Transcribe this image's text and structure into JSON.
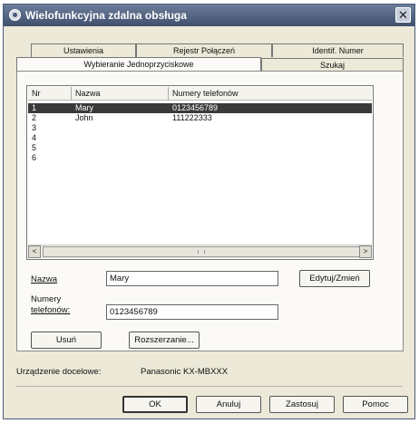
{
  "window": {
    "title": "Wielofunkcyjna zdalna obsługa",
    "close_glyph": "✕"
  },
  "tabs": {
    "row1": [
      "Ustawienia",
      "Rejestr Połączeń",
      "Identif. Numer"
    ],
    "row2": [
      "Wybieranie Jednoprzyciskowe",
      "Szukaj"
    ],
    "active": "Wybieranie Jednoprzyciskowe"
  },
  "list": {
    "headers": [
      "Nr",
      "Nazwa",
      "Numery telefonów"
    ],
    "rows": [
      {
        "nr": "1",
        "name": "Mary",
        "phone": "0123456789",
        "selected": true
      },
      {
        "nr": "2",
        "name": "John",
        "phone": "111222333"
      },
      {
        "nr": "3",
        "name": "",
        "phone": ""
      },
      {
        "nr": "4",
        "name": "",
        "phone": ""
      },
      {
        "nr": "5",
        "name": "",
        "phone": ""
      },
      {
        "nr": "6",
        "name": "",
        "phone": ""
      }
    ],
    "scroll_left": "<",
    "scroll_right": ">"
  },
  "form": {
    "name_label": "Nazwa",
    "name_value": "Mary",
    "phone_label_line1": "Numery",
    "phone_label_line2": "telefonów:",
    "phone_value": "0123456789",
    "edit_button": "Edytuj/Zmień",
    "delete_button": "Usuń",
    "expand_button": "Rozszerzanie..."
  },
  "device": {
    "label": "Urządzenie docelowe:",
    "value": "Panasonic KX-MBXXX"
  },
  "footer": {
    "ok": "OK",
    "cancel": "Anuluj",
    "apply": "Zastosuj",
    "help": "Pomoc"
  }
}
